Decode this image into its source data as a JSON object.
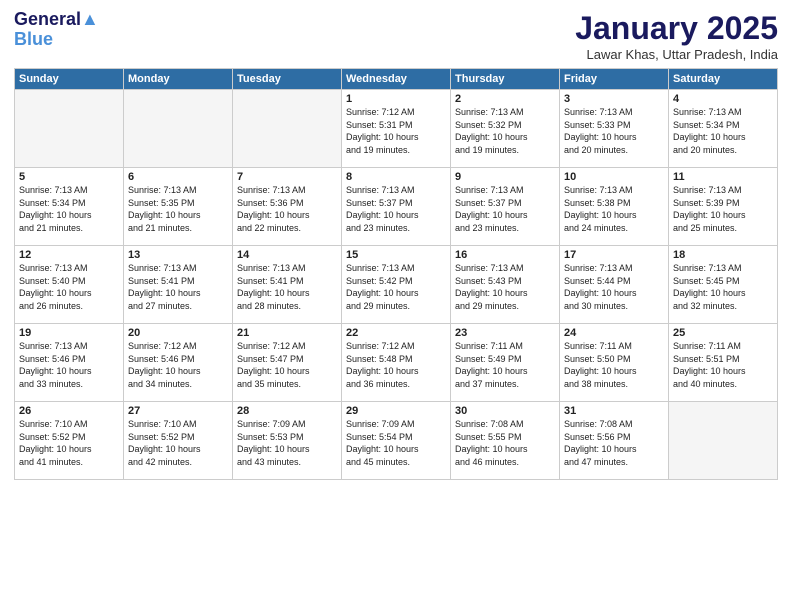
{
  "header": {
    "logo_line1": "General",
    "logo_line2": "Blue",
    "month": "January 2025",
    "location": "Lawar Khas, Uttar Pradesh, India"
  },
  "weekdays": [
    "Sunday",
    "Monday",
    "Tuesday",
    "Wednesday",
    "Thursday",
    "Friday",
    "Saturday"
  ],
  "weeks": [
    [
      {
        "day": "",
        "empty": true
      },
      {
        "day": "",
        "empty": true
      },
      {
        "day": "",
        "empty": true
      },
      {
        "day": "1",
        "sunrise": "7:12 AM",
        "sunset": "5:31 PM",
        "daylight": "10 hours and 19 minutes."
      },
      {
        "day": "2",
        "sunrise": "7:13 AM",
        "sunset": "5:32 PM",
        "daylight": "10 hours and 19 minutes."
      },
      {
        "day": "3",
        "sunrise": "7:13 AM",
        "sunset": "5:33 PM",
        "daylight": "10 hours and 20 minutes."
      },
      {
        "day": "4",
        "sunrise": "7:13 AM",
        "sunset": "5:34 PM",
        "daylight": "10 hours and 20 minutes."
      }
    ],
    [
      {
        "day": "5",
        "sunrise": "7:13 AM",
        "sunset": "5:34 PM",
        "daylight": "10 hours and 21 minutes."
      },
      {
        "day": "6",
        "sunrise": "7:13 AM",
        "sunset": "5:35 PM",
        "daylight": "10 hours and 21 minutes."
      },
      {
        "day": "7",
        "sunrise": "7:13 AM",
        "sunset": "5:36 PM",
        "daylight": "10 hours and 22 minutes."
      },
      {
        "day": "8",
        "sunrise": "7:13 AM",
        "sunset": "5:37 PM",
        "daylight": "10 hours and 23 minutes."
      },
      {
        "day": "9",
        "sunrise": "7:13 AM",
        "sunset": "5:37 PM",
        "daylight": "10 hours and 23 minutes."
      },
      {
        "day": "10",
        "sunrise": "7:13 AM",
        "sunset": "5:38 PM",
        "daylight": "10 hours and 24 minutes."
      },
      {
        "day": "11",
        "sunrise": "7:13 AM",
        "sunset": "5:39 PM",
        "daylight": "10 hours and 25 minutes."
      }
    ],
    [
      {
        "day": "12",
        "sunrise": "7:13 AM",
        "sunset": "5:40 PM",
        "daylight": "10 hours and 26 minutes."
      },
      {
        "day": "13",
        "sunrise": "7:13 AM",
        "sunset": "5:41 PM",
        "daylight": "10 hours and 27 minutes."
      },
      {
        "day": "14",
        "sunrise": "7:13 AM",
        "sunset": "5:41 PM",
        "daylight": "10 hours and 28 minutes."
      },
      {
        "day": "15",
        "sunrise": "7:13 AM",
        "sunset": "5:42 PM",
        "daylight": "10 hours and 29 minutes."
      },
      {
        "day": "16",
        "sunrise": "7:13 AM",
        "sunset": "5:43 PM",
        "daylight": "10 hours and 29 minutes."
      },
      {
        "day": "17",
        "sunrise": "7:13 AM",
        "sunset": "5:44 PM",
        "daylight": "10 hours and 30 minutes."
      },
      {
        "day": "18",
        "sunrise": "7:13 AM",
        "sunset": "5:45 PM",
        "daylight": "10 hours and 32 minutes."
      }
    ],
    [
      {
        "day": "19",
        "sunrise": "7:13 AM",
        "sunset": "5:46 PM",
        "daylight": "10 hours and 33 minutes."
      },
      {
        "day": "20",
        "sunrise": "7:12 AM",
        "sunset": "5:46 PM",
        "daylight": "10 hours and 34 minutes."
      },
      {
        "day": "21",
        "sunrise": "7:12 AM",
        "sunset": "5:47 PM",
        "daylight": "10 hours and 35 minutes."
      },
      {
        "day": "22",
        "sunrise": "7:12 AM",
        "sunset": "5:48 PM",
        "daylight": "10 hours and 36 minutes."
      },
      {
        "day": "23",
        "sunrise": "7:11 AM",
        "sunset": "5:49 PM",
        "daylight": "10 hours and 37 minutes."
      },
      {
        "day": "24",
        "sunrise": "7:11 AM",
        "sunset": "5:50 PM",
        "daylight": "10 hours and 38 minutes."
      },
      {
        "day": "25",
        "sunrise": "7:11 AM",
        "sunset": "5:51 PM",
        "daylight": "10 hours and 40 minutes."
      }
    ],
    [
      {
        "day": "26",
        "sunrise": "7:10 AM",
        "sunset": "5:52 PM",
        "daylight": "10 hours and 41 minutes."
      },
      {
        "day": "27",
        "sunrise": "7:10 AM",
        "sunset": "5:52 PM",
        "daylight": "10 hours and 42 minutes."
      },
      {
        "day": "28",
        "sunrise": "7:09 AM",
        "sunset": "5:53 PM",
        "daylight": "10 hours and 43 minutes."
      },
      {
        "day": "29",
        "sunrise": "7:09 AM",
        "sunset": "5:54 PM",
        "daylight": "10 hours and 45 minutes."
      },
      {
        "day": "30",
        "sunrise": "7:08 AM",
        "sunset": "5:55 PM",
        "daylight": "10 hours and 46 minutes."
      },
      {
        "day": "31",
        "sunrise": "7:08 AM",
        "sunset": "5:56 PM",
        "daylight": "10 hours and 47 minutes."
      },
      {
        "day": "",
        "empty": true
      }
    ]
  ],
  "labels": {
    "sunrise": "Sunrise:",
    "sunset": "Sunset:",
    "daylight": "Daylight:"
  }
}
